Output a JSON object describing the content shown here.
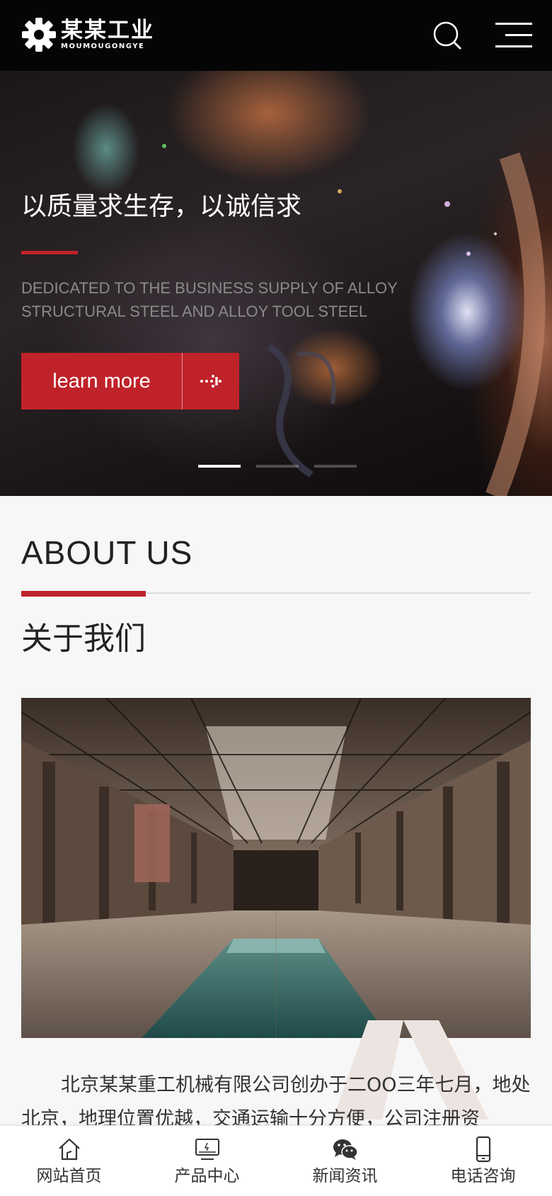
{
  "header": {
    "logo_cn": "某某工业",
    "logo_en": "MOUMOUGONGYE",
    "icons": {
      "logo": "gear-icon",
      "search": "search-icon",
      "menu": "menu-icon"
    }
  },
  "hero": {
    "title": "以质量求生存，以诚信求",
    "subtitle": "DEDICATED TO THE BUSINESS SUPPLY OF ALLOY STRUCTURAL STEEL AND ALLOY TOOL STEEL",
    "button_label": "learn more",
    "button_icon": "arrow-right-dotted-icon",
    "slide_count": 3,
    "active_slide": 1,
    "accent_color": "#c0222a"
  },
  "about": {
    "heading_en": "ABOUT US",
    "heading_cn": "关于我们",
    "image": "factory-hall-photo",
    "text": "北京某某重工机械有限公司创办于二OO三年七月，地处北京，地理位置优越，交通运输十分方便，公司注册资"
  },
  "bottom_nav": {
    "items": [
      {
        "label": "网站首页",
        "icon": "home-icon"
      },
      {
        "label": "产品中心",
        "icon": "monitor-icon"
      },
      {
        "label": "新闻资讯",
        "icon": "wechat-icon"
      },
      {
        "label": "电话咨询",
        "icon": "phone-icon"
      }
    ]
  }
}
